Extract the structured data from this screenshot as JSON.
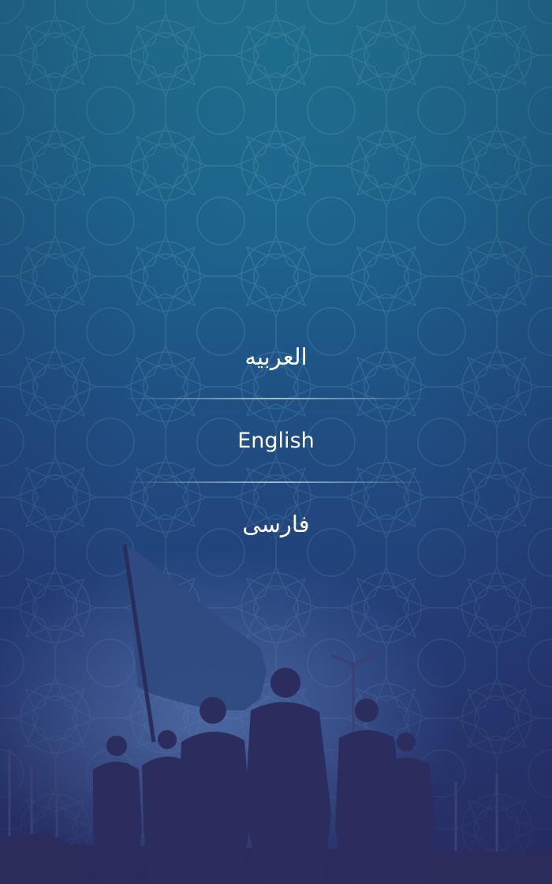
{
  "languages": [
    {
      "label": "العربيه"
    },
    {
      "label": "English"
    },
    {
      "label": "فارسی"
    }
  ],
  "colors": {
    "bg_top": "#1f7f98",
    "bg_bottom": "#2a2f68",
    "text": "#ffffff",
    "silhouette": "#2b2d5e"
  }
}
